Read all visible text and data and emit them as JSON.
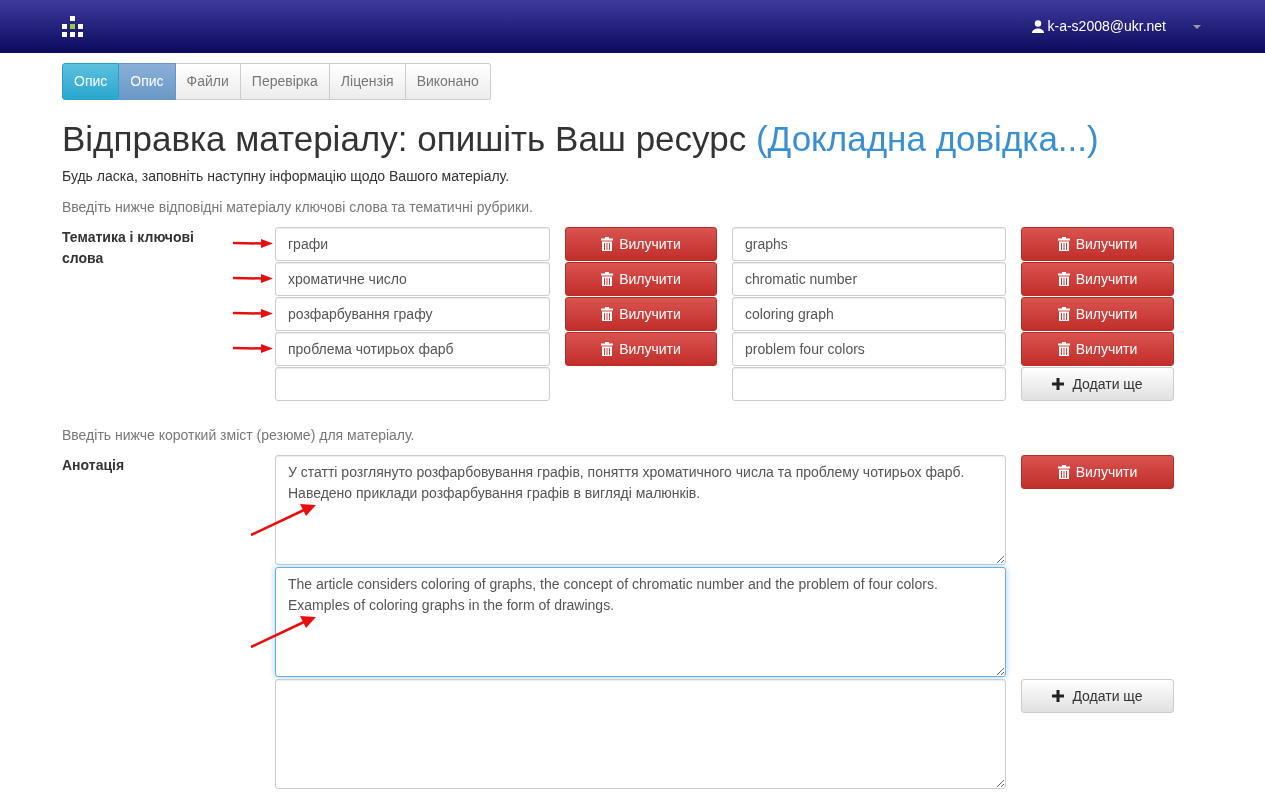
{
  "navbar": {
    "user": "k-a-s2008@ukr.net"
  },
  "steps": [
    {
      "label": "Опис",
      "completed": true,
      "selected": false
    },
    {
      "label": "Опис",
      "completed": false,
      "selected": true
    },
    {
      "label": "Файли",
      "completed": false,
      "selected": false
    },
    {
      "label": "Перевірка",
      "completed": false,
      "selected": false
    },
    {
      "label": "Ліцензія",
      "completed": false,
      "selected": false
    },
    {
      "label": "Виконано",
      "completed": false,
      "selected": false
    }
  ],
  "title": "Відправка матеріалу: опишіть Ваш ресурс",
  "help_link": "(Докладна довідка...)",
  "intro": "Будь ласка, заповніть наступну інформацію щодо Вашого матеріалу.",
  "keywords": {
    "hint": "Введіть нижче відповідні матеріалу ключові слова та тематичні рубрики.",
    "label": "Тематика і ключові слова",
    "columns": [
      {
        "items": [
          {
            "value": "графи",
            "arrow": true,
            "remove_label": "Вилучити"
          },
          {
            "value": "хроматичне число",
            "arrow": true,
            "remove_label": "Вилучити"
          },
          {
            "value": "розфарбування графу",
            "arrow": true,
            "remove_label": "Вилучити"
          },
          {
            "value": "проблема чотирьох фарб",
            "arrow": true,
            "remove_label": "Вилучити"
          }
        ]
      },
      {
        "items": [
          {
            "value": "graphs",
            "arrow": false,
            "remove_label": "Вилучити"
          },
          {
            "value": "chromatic number",
            "arrow": false,
            "remove_label": "Вилучити"
          },
          {
            "value": "coloring graph",
            "arrow": false,
            "remove_label": "Вилучити"
          },
          {
            "value": "problem four colors",
            "arrow": false,
            "remove_label": "Вилучити"
          }
        ],
        "add_label": "Додати ще"
      }
    ]
  },
  "abstract": {
    "hint": "Введіть нижче короткий зміст (резюме) для матеріалу.",
    "label": "Анотація",
    "entries": [
      {
        "value": "У статті розглянуто розфарбовування графів, поняття хроматичного числа та проблему чотирьох фарб. Наведено приклади розфарбування графів в вигляді малюнків.",
        "arrow": true,
        "focused": false,
        "remove_label": "Вилучити"
      },
      {
        "value": "The article considers coloring of graphs, the concept of chromatic number and the problem of four colors. Examples of coloring graphs in the form of drawings.",
        "arrow": true,
        "focused": true
      }
    ],
    "add_label": "Додати ще"
  }
}
